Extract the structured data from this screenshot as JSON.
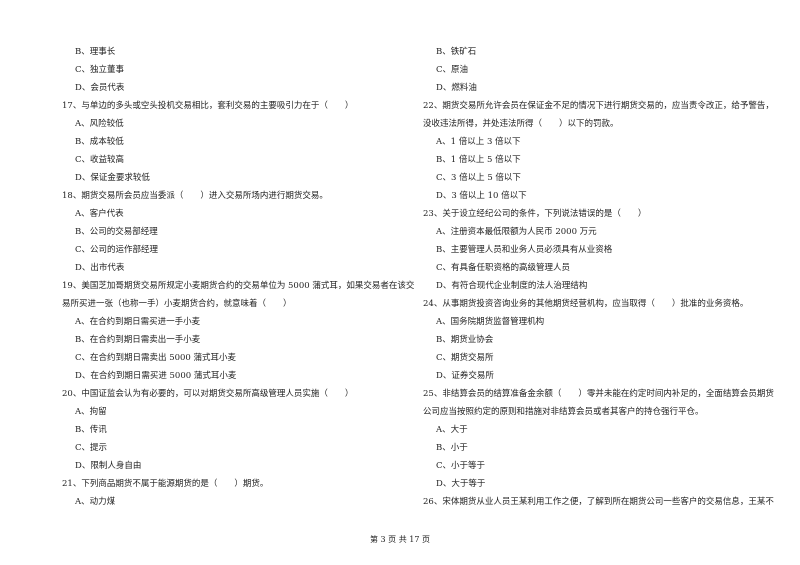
{
  "left_column": [
    {
      "type": "opt",
      "text": "B、理事长"
    },
    {
      "type": "opt",
      "text": "C、独立董事"
    },
    {
      "type": "opt",
      "text": "D、会员代表"
    },
    {
      "type": "q",
      "text": "17、与单边的多头或空头投机交易相比，套利交易的主要吸引力在于（　　）"
    },
    {
      "type": "opt",
      "text": "A、风险较低"
    },
    {
      "type": "opt",
      "text": "B、成本较低"
    },
    {
      "type": "opt",
      "text": "C、收益较高"
    },
    {
      "type": "opt",
      "text": "D、保证金要求较低"
    },
    {
      "type": "q",
      "text": "18、期货交易所会员应当委派（　　）进入交易所场内进行期货交易。"
    },
    {
      "type": "opt",
      "text": "A、客户代表"
    },
    {
      "type": "opt",
      "text": "B、公司的交易部经理"
    },
    {
      "type": "opt",
      "text": "C、公司的运作部经理"
    },
    {
      "type": "opt",
      "text": "D、出市代表"
    },
    {
      "type": "q",
      "text": "19、美国芝加哥期货交易所规定小麦期货合约的交易单位为 5000 蒲式耳，如果交易者在该交"
    },
    {
      "type": "q",
      "text": "易所买进一张（也称一手）小麦期货合约，就意味着（　　）"
    },
    {
      "type": "opt",
      "text": "A、在合约到期日需买进一手小麦"
    },
    {
      "type": "opt",
      "text": "B、在合约到期日需卖出一手小麦"
    },
    {
      "type": "opt",
      "text": "C、在合约到期日需卖出 5000 蒲式耳小麦"
    },
    {
      "type": "opt",
      "text": "D、在合约到期日需买进 5000 蒲式耳小麦"
    },
    {
      "type": "q",
      "text": "20、中国证监会认为有必要的，可以对期货交易所高级管理人员实施（　　）"
    },
    {
      "type": "opt",
      "text": "A、拘留"
    },
    {
      "type": "opt",
      "text": "B、传讯"
    },
    {
      "type": "opt",
      "text": "C、提示"
    },
    {
      "type": "opt",
      "text": "D、限制人身自由"
    },
    {
      "type": "q",
      "text": "21、下列商品期货不属于能源期货的是（　　）期货。"
    },
    {
      "type": "opt",
      "text": "A、动力煤"
    }
  ],
  "right_column": [
    {
      "type": "opt",
      "text": "B、铁矿石"
    },
    {
      "type": "opt",
      "text": "C、原油"
    },
    {
      "type": "opt",
      "text": "D、燃料油"
    },
    {
      "type": "q",
      "text": "22、期货交易所允许会员在保证金不足的情况下进行期货交易的，应当责令改正，给予警告，"
    },
    {
      "type": "q",
      "text": "没收违法所得，并处违法所得（　　）以下的罚款。"
    },
    {
      "type": "opt",
      "text": "A、1 倍以上 3 倍以下"
    },
    {
      "type": "opt",
      "text": "B、1 倍以上 5 倍以下"
    },
    {
      "type": "opt",
      "text": "C、3 倍以上 5 倍以下"
    },
    {
      "type": "opt",
      "text": "D、3 倍以上 10 倍以下"
    },
    {
      "type": "q",
      "text": "23、关于设立经纪公司的条件，下列说法错误的是（　　）"
    },
    {
      "type": "opt",
      "text": "A、注册资本最低限额为人民币 2000 万元"
    },
    {
      "type": "opt",
      "text": "B、主要管理人员和业务人员必须具有从业资格"
    },
    {
      "type": "opt",
      "text": "C、有具备任职资格的高级管理人员"
    },
    {
      "type": "opt",
      "text": "D、有符合现代企业制度的法人治理结构"
    },
    {
      "type": "q",
      "text": "24、从事期货投资咨询业务的其他期货经营机构，应当取得（　　）批准的业务资格。"
    },
    {
      "type": "opt",
      "text": "A、国务院期货监督管理机构"
    },
    {
      "type": "opt",
      "text": "B、期货业协会"
    },
    {
      "type": "opt",
      "text": "C、期货交易所"
    },
    {
      "type": "opt",
      "text": "D、证券交易所"
    },
    {
      "type": "q",
      "text": "25、非结算会员的结算准备金余额（　　）零并未能在约定时间内补足的，全面结算会员期货"
    },
    {
      "type": "q",
      "text": "公司应当按照约定的原则和措施对非结算会员或者其客户的持仓强行平仓。"
    },
    {
      "type": "opt",
      "text": "A、大于"
    },
    {
      "type": "opt",
      "text": "B、小于"
    },
    {
      "type": "opt",
      "text": "C、小于等于"
    },
    {
      "type": "opt",
      "text": "D、大于等于"
    },
    {
      "type": "q",
      "text": "26、宋体期货从业人员王某利用工作之便，了解到所在期货公司一些客户的交易信息，王某不"
    }
  ],
  "footer": {
    "page_label": "第 3 页 共 17 页"
  }
}
